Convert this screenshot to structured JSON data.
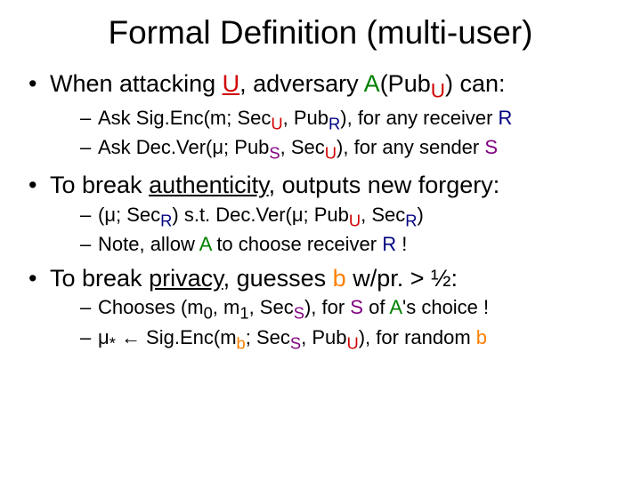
{
  "title": "Formal Definition (multi-user)",
  "b1_pre": "When attacking ",
  "b1_U": "U",
  "b1_mid": ", adversary ",
  "b1_A": "A",
  "b1_p1": "(Pub",
  "b1_sub": "U",
  "b1_p2": ") can:",
  "s1a_pre": "Ask Sig.Enc(m; Sec",
  "s1a_U": "U",
  "s1a_mid": ", Pub",
  "s1a_R": "R",
  "s1a_post": "), for any receiver ",
  "s1a_R2": "R",
  "s1b_pre": "Ask Dec.Ver(μ; Pub",
  "s1b_S": "S",
  "s1b_mid": ", Sec",
  "s1b_U": "U",
  "s1b_post": "), for any sender ",
  "s1b_S2": "S",
  "b2_pre": "To break ",
  "b2_auth": "authenticity",
  "b2_post": ", outputs new forgery:",
  "s2a_pre": "(μ; Sec",
  "s2a_R": "R",
  "s2a_mid": ") s.t. Dec.Ver(μ; Pub",
  "s2a_U": "U",
  "s2a_mid2": ", Sec",
  "s2a_R2": "R",
  "s2a_post": ")",
  "s2b_pre": "Note, allow ",
  "s2b_A": "A",
  "s2b_mid": " to choose receiver ",
  "s2b_R": "R",
  "s2b_post": " !",
  "b3_pre": "To break ",
  "b3_priv": "privacy",
  "b3_mid": ", guesses ",
  "b3_b": "b",
  "b3_post": " w/pr. > ½:",
  "s3a_pre": "Chooses (m",
  "s3a_0": "0",
  "s3a_mid1": ", m",
  "s3a_1": "1",
  "s3a_mid2": ", Sec",
  "s3a_S": "S",
  "s3a_mid3": "), for ",
  "s3a_S2": "S",
  "s3a_of": " of ",
  "s3a_A": "A",
  "s3a_post": "'s choice !",
  "s3b_mu": "μ",
  "s3b_star": "*",
  "s3b_arrow": " ← Sig.Enc(m",
  "s3b_b": "b",
  "s3b_mid": "; Sec",
  "s3b_S": "S",
  "s3b_mid2": ", Pub",
  "s3b_U": "U",
  "s3b_mid3": "), for random ",
  "s3b_b2": "b"
}
